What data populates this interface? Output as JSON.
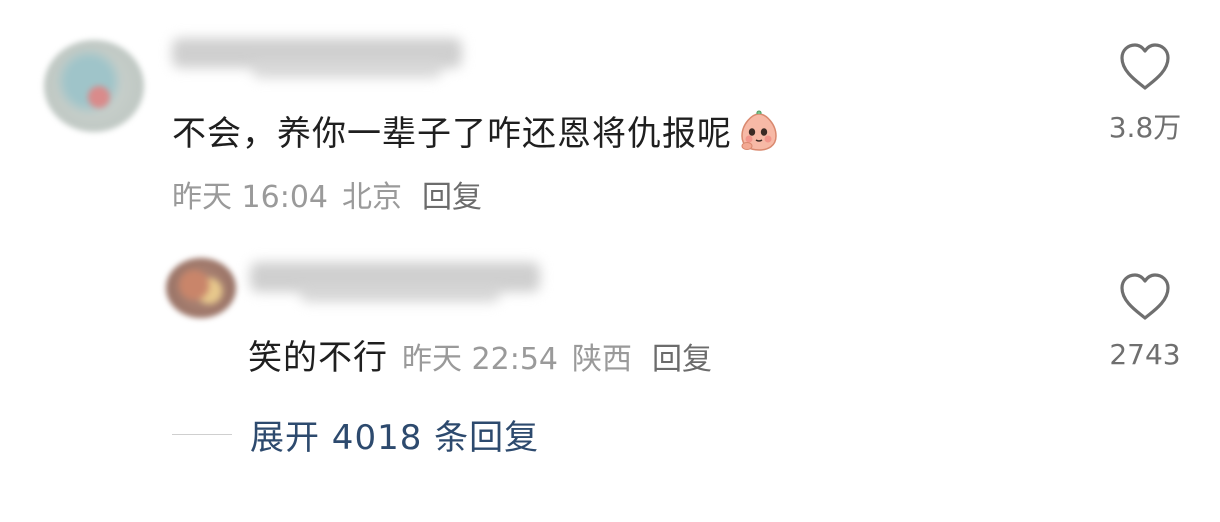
{
  "comment": {
    "text": "不会，养你一辈子了咋还恩将仇报呢",
    "emoji_icon": "shy-bun-emoji-icon",
    "time": "昨天 16:04",
    "location": "北京",
    "reply_label": "回复",
    "like_count": "3.8万"
  },
  "reply": {
    "text": "笑的不行",
    "time": "昨天 22:54",
    "location": "陕西",
    "reply_label": "回复",
    "like_count": "2743"
  },
  "expand": {
    "label": "展开 4018 条回复"
  },
  "colors": {
    "text_primary": "#1f1f1f",
    "text_meta": "#9a9a9a",
    "link_blue": "#2d4a6e",
    "heart_stroke": "#6f6f6f"
  }
}
